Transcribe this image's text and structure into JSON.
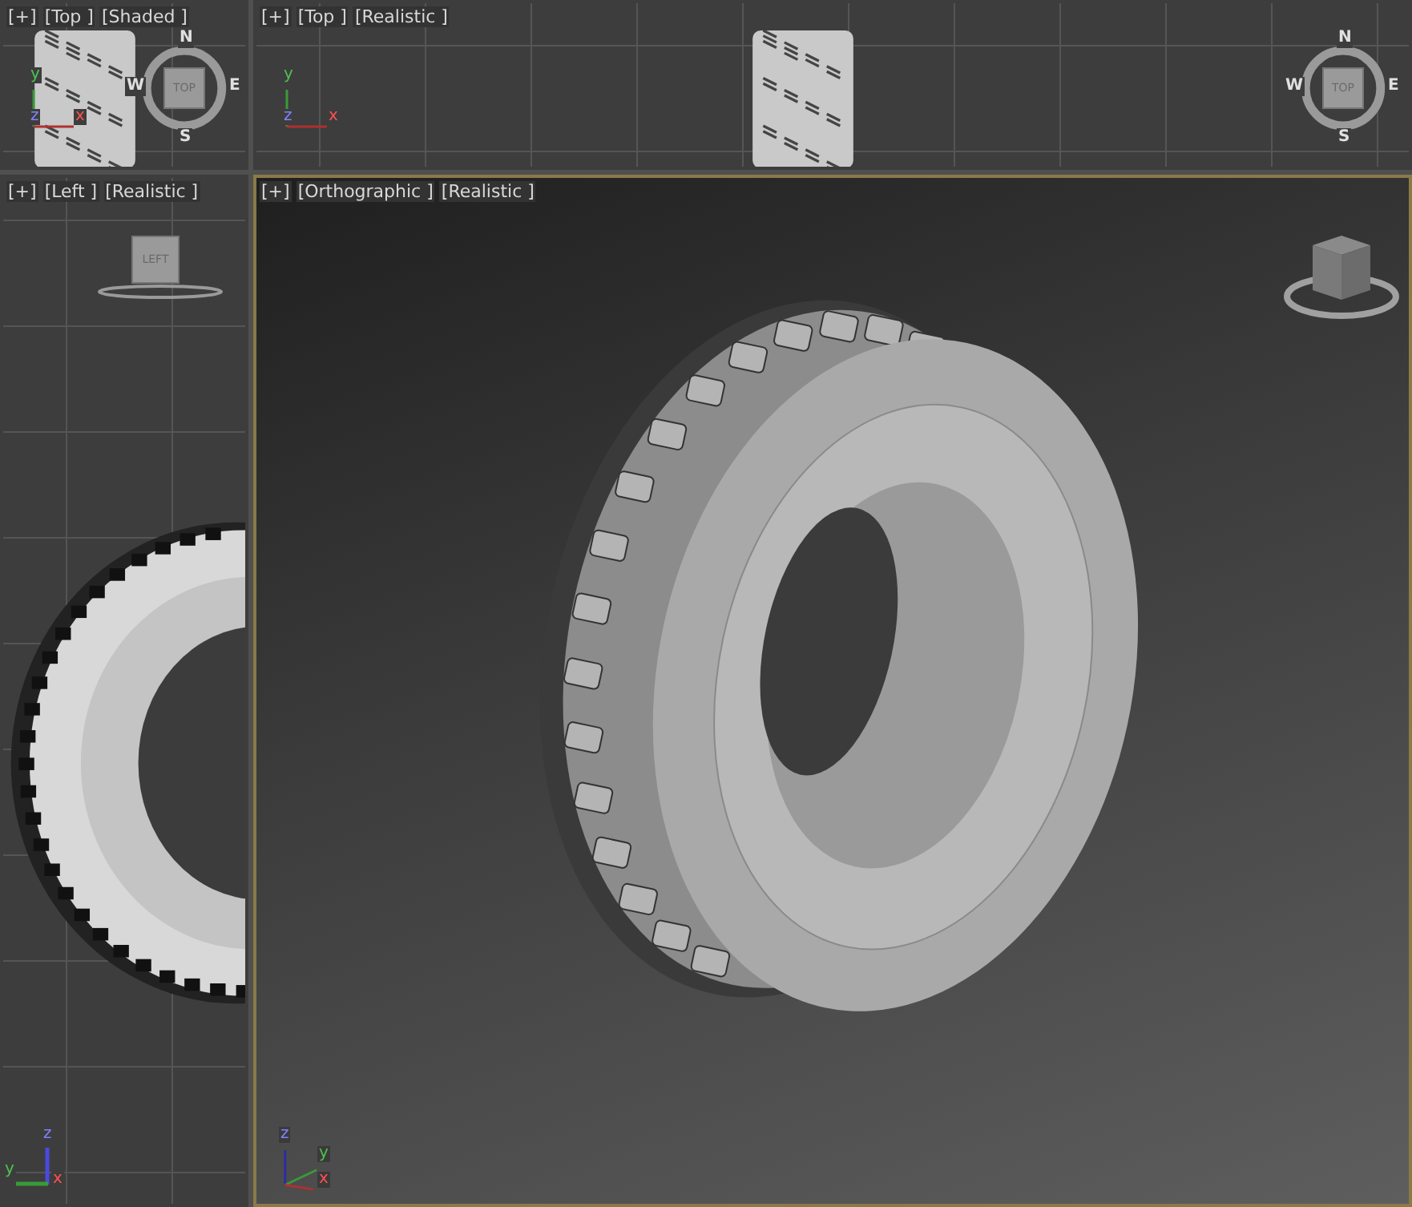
{
  "viewports": [
    {
      "menu": "[+]",
      "view": "[Top ]",
      "shading": "[Shaded ]",
      "active": false,
      "kind": "top",
      "cube": {
        "kind": "compass",
        "face": "TOP",
        "letters": [
          "N",
          "E",
          "S",
          "W"
        ]
      },
      "axes": {
        "kind": "flat",
        "letters": [
          "y",
          "z",
          "x"
        ]
      }
    },
    {
      "menu": "[+]",
      "view": "[Top ]",
      "shading": "[Realistic ]",
      "active": false,
      "kind": "top",
      "cube": {
        "kind": "compass",
        "face": "TOP",
        "letters": [
          "N",
          "E",
          "S",
          "W"
        ]
      },
      "axes": {
        "kind": "flat",
        "letters": [
          "y",
          "z",
          "x"
        ]
      }
    },
    {
      "menu": "[+]",
      "view": "[Left ]",
      "shading": "[Realistic ]",
      "active": false,
      "kind": "side",
      "cube": {
        "kind": "flat",
        "face": "LEFT"
      },
      "axes": {
        "kind": "side",
        "letters": [
          "z",
          "y",
          "x"
        ]
      }
    },
    {
      "menu": "[+]",
      "view": "[Orthographic ]",
      "shading": "[Realistic ]",
      "active": true,
      "kind": "ortho",
      "cube": {
        "kind": "cube"
      },
      "axes": {
        "kind": "persp",
        "letters": [
          "z",
          "y",
          "x"
        ]
      }
    }
  ]
}
